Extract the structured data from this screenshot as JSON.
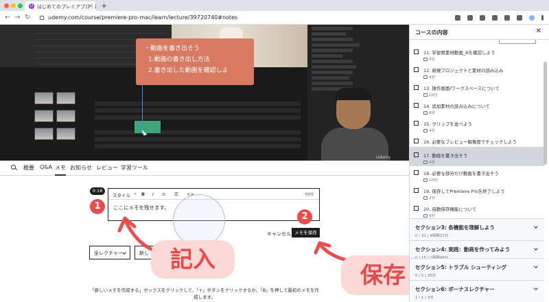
{
  "browser": {
    "tab_title": "はじめてのプレミアプロ｜初級入門",
    "url": "udemy.com/course/premiere-pro-mac/learn/lecture/39720740#notes"
  },
  "video": {
    "overlay_lines": [
      "・動画を書き出そう",
      "1.動画の書き出し方法",
      "2.書き出した動画を確認しよ"
    ],
    "watermark": "Udemy"
  },
  "lecture_tabs": [
    "概要",
    "Q&A",
    "メモ",
    "お知らせ",
    "レビュー",
    "学習ツール"
  ],
  "notes": {
    "timestamp": "0:18",
    "style_label": "スタイル",
    "bold": "B",
    "italic": "I",
    "code": "<>",
    "char_count": "989",
    "input_text": "ここにメモを残せます。",
    "cancel_label": "キャンセル",
    "save_label": "メモを保存",
    "filter_lectures": "全レクチャー",
    "filter_sort": "新し",
    "hint": "「新しいメモを作成する」ボックスをクリックして、「+」ボタンをクリックするか、「B」を押して最初のメモを作成します。"
  },
  "annotations": {
    "step1": "1",
    "step2": "2",
    "write_label": "記入",
    "save_label": "保存",
    "color": "#ea4d4d"
  },
  "sidebar": {
    "title": "コースの内容",
    "lectures": [
      {
        "title": "11. 学習用素材動画_Aを確認しよう",
        "duration": "4分",
        "active": false
      },
      {
        "title": "12. 新規プロジェクトと素材の読み込み",
        "duration": "4分",
        "active": false
      },
      {
        "title": "13. 操作画面/ワークスペースについて",
        "duration": "10分",
        "active": false
      },
      {
        "title": "14. 追加素材の読み込みについて",
        "duration": "8分",
        "active": false
      },
      {
        "title": "15. クリップを並べよう",
        "duration": "4分",
        "active": false
      },
      {
        "title": "16. 必要なプレビュー解像度でチェックしよう",
        "duration": "3分",
        "active": false
      },
      {
        "title": "17. 動画を書き出そう",
        "duration": "4分",
        "active": true
      },
      {
        "title": "18. 必要な部分だけ動画を書き出そう",
        "duration": "10分",
        "active": false
      },
      {
        "title": "19. 保存してPremiere Proを終了しよう",
        "duration": "2分",
        "active": false
      },
      {
        "title": "20. 自動保存機能について",
        "duration": "9分",
        "active": false
      }
    ],
    "sections": [
      {
        "title": "セクション3: 各機能を理解しよう",
        "sub": "0 / 31 | 4時間27分"
      },
      {
        "title": "セクション4: 実践：動画を作ってみよう",
        "sub": "0 / 15 | 1時間48分"
      },
      {
        "title": "セクション5: トラブル シューティング",
        "sub": "0 / 5 | 25分"
      },
      {
        "title": "セクション6: ボーナスレクチャー",
        "sub": "1 / 1 | 3分"
      }
    ]
  }
}
